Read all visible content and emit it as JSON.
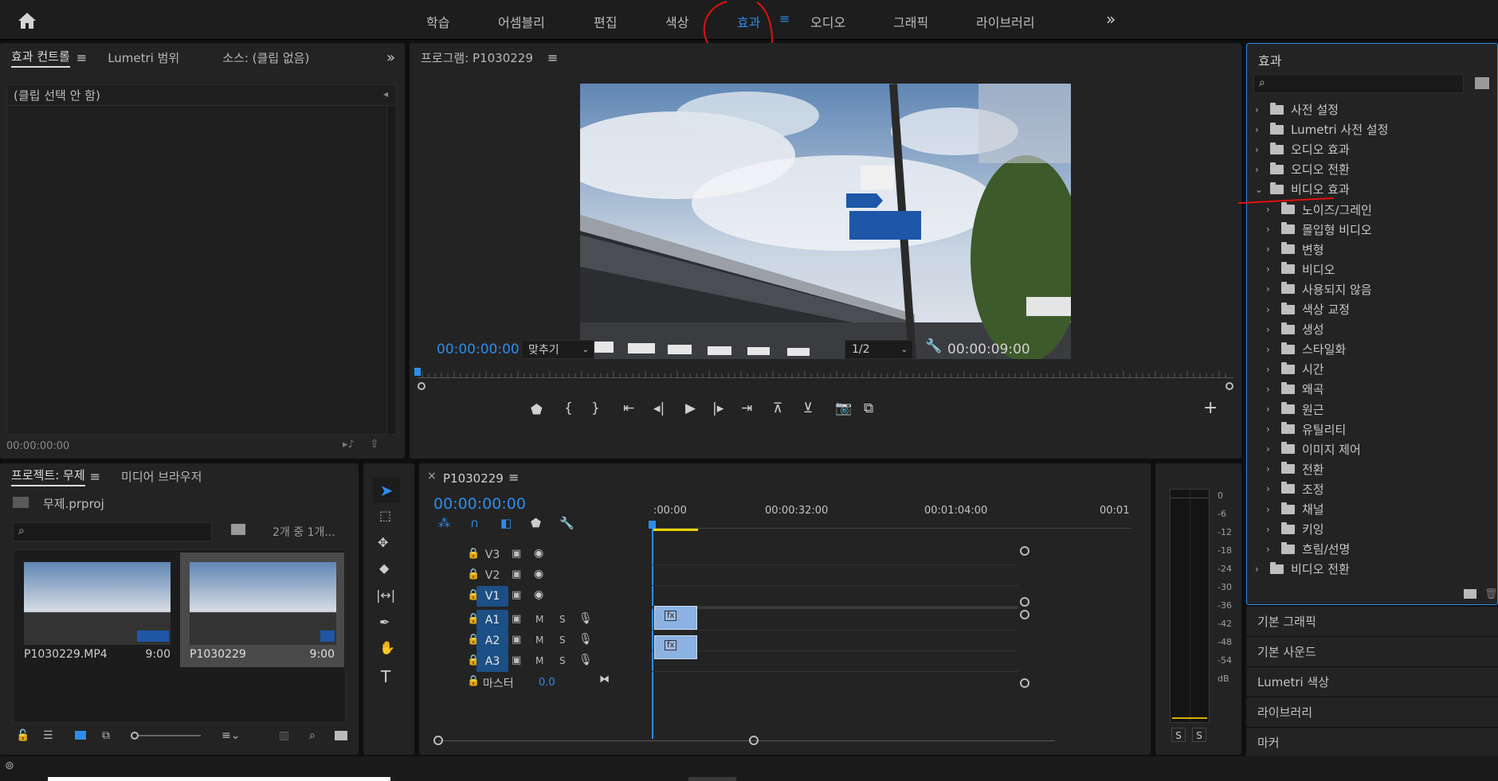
{
  "workspaces": {
    "tabs": [
      "학습",
      "어셈블리",
      "편집",
      "색상",
      "효과",
      "오디오",
      "그래픽",
      "라이브러리"
    ],
    "active_index": 4,
    "overflow": "»"
  },
  "effect_controls": {
    "tabs": [
      "효과 컨트롤",
      "Lumetri 범위",
      "소스: (클립 없음)"
    ],
    "no_clip": "(클립 선택 안 함)",
    "timecode": "00:00:00:00"
  },
  "program": {
    "title": "프로그램: P1030229",
    "timecode": "00:00:00:00",
    "fit": "맞추기",
    "resolution": "1/2",
    "duration": "00:00:09:00",
    "playhead_fraction": 0.0
  },
  "project": {
    "tabs": [
      "프로젝트: 무제",
      "미디어 브라우저"
    ],
    "file": "무제.prproj",
    "count": "2개 중 1개...",
    "items": [
      {
        "name": "P1030229.MP4",
        "duration": "9:00"
      },
      {
        "name": "P1030229",
        "duration": "9:00"
      }
    ]
  },
  "timeline": {
    "title": "P1030229",
    "timecode": "00:00:00:00",
    "ruler": [
      ":00:00",
      "00:00:32:00",
      "00:01:04:00",
      "00:01"
    ],
    "video_tracks": [
      "V3",
      "V2",
      "V1"
    ],
    "audio_tracks": [
      "A1",
      "A2",
      "A3"
    ],
    "track_m": "M",
    "track_s": "S",
    "master": "마스터",
    "master_value": "0.0",
    "clip_fx": "fx"
  },
  "meter": {
    "scale": [
      "0",
      "-6",
      "-12",
      "-18",
      "-24",
      "-30",
      "-36",
      "-42",
      "-48",
      "-54",
      "dB"
    ],
    "solo_left": "S",
    "solo_right": "S"
  },
  "effects": {
    "title": "효과",
    "items": [
      {
        "label": "사전 설정",
        "level": 0,
        "open": false,
        "kind": "preset"
      },
      {
        "label": "Lumetri 사전 설정",
        "level": 0,
        "open": false,
        "kind": "preset"
      },
      {
        "label": "오디오 효과",
        "level": 0,
        "open": false,
        "kind": "folder"
      },
      {
        "label": "오디오 전환",
        "level": 0,
        "open": false,
        "kind": "folder"
      },
      {
        "label": "비디오 효과",
        "level": 0,
        "open": true,
        "kind": "folder"
      },
      {
        "label": "노이즈/그레인",
        "level": 1,
        "open": false,
        "kind": "folder"
      },
      {
        "label": "몰입형 비디오",
        "level": 1,
        "open": false,
        "kind": "folder"
      },
      {
        "label": "변형",
        "level": 1,
        "open": false,
        "kind": "folder"
      },
      {
        "label": "비디오",
        "level": 1,
        "open": false,
        "kind": "folder"
      },
      {
        "label": "사용되지 않음",
        "level": 1,
        "open": false,
        "kind": "folder"
      },
      {
        "label": "색상 교정",
        "level": 1,
        "open": false,
        "kind": "folder"
      },
      {
        "label": "생성",
        "level": 1,
        "open": false,
        "kind": "folder"
      },
      {
        "label": "스타일화",
        "level": 1,
        "open": false,
        "kind": "folder"
      },
      {
        "label": "시간",
        "level": 1,
        "open": false,
        "kind": "folder"
      },
      {
        "label": "왜곡",
        "level": 1,
        "open": false,
        "kind": "folder"
      },
      {
        "label": "원근",
        "level": 1,
        "open": false,
        "kind": "folder"
      },
      {
        "label": "유틸리티",
        "level": 1,
        "open": false,
        "kind": "folder"
      },
      {
        "label": "이미지 제어",
        "level": 1,
        "open": false,
        "kind": "folder"
      },
      {
        "label": "전환",
        "level": 1,
        "open": false,
        "kind": "folder"
      },
      {
        "label": "조정",
        "level": 1,
        "open": false,
        "kind": "folder"
      },
      {
        "label": "채널",
        "level": 1,
        "open": false,
        "kind": "folder"
      },
      {
        "label": "키잉",
        "level": 1,
        "open": false,
        "kind": "folder"
      },
      {
        "label": "흐림/선명",
        "level": 1,
        "open": false,
        "kind": "folder"
      },
      {
        "label": "비디오 전환",
        "level": 0,
        "open": false,
        "kind": "folder"
      }
    ]
  },
  "side_panels": [
    "기본 그래픽",
    "기본 사운드",
    "Lumetri 색상",
    "라이브러리",
    "마커"
  ],
  "colors": {
    "accent": "#2d8ceb",
    "panel": "#232323",
    "annotation": "#e01010"
  }
}
